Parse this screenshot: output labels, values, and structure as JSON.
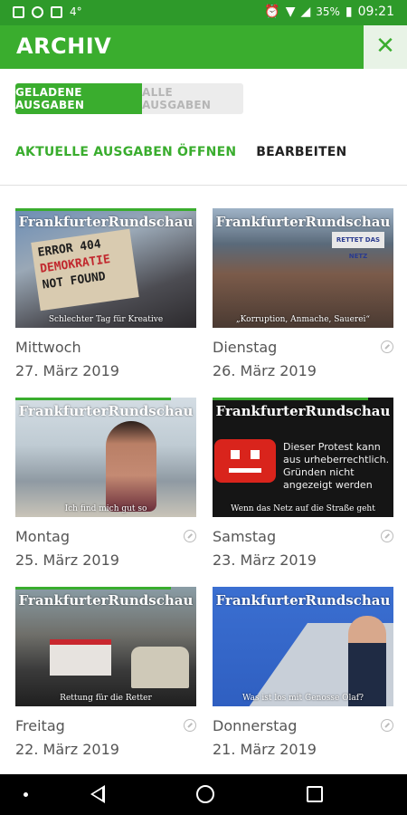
{
  "status": {
    "battery": "35%",
    "time": "09:21",
    "notif_text": "4°"
  },
  "appbar": {
    "title": "ARCHIV",
    "close_icon": "close-icon"
  },
  "segments": {
    "loaded": "GELADENE AUSGABEN",
    "all": "ALLE AUSGABEN"
  },
  "actions": {
    "open_current": "AKTUELLE AUSGABEN ÖFFNEN",
    "edit": "BEARBEITEN"
  },
  "issues": [
    {
      "brand": "FrankfurterRundschau",
      "caption": "Schlechter Tag für Kreative",
      "day": "Mittwoch",
      "date": "27. März 2019",
      "sign_l1": "ERROR 404",
      "sign_l2": "DEMOKRATIE",
      "sign_l3": "NOT FOUND",
      "progress": 1.0,
      "downloaded_icon": false
    },
    {
      "brand": "FrankfurterRundschau",
      "caption": "„Korruption, Anmache, Sauerei“",
      "day": "Dienstag",
      "date": "26. März 2019",
      "banner": "RETTET DAS NETZ",
      "progress": 0.0,
      "downloaded_icon": true
    },
    {
      "brand": "FrankfurterRundschau",
      "caption": "Ich find mich gut so",
      "day": "Montag",
      "date": "25. März 2019",
      "progress": 0.86,
      "downloaded_icon": true
    },
    {
      "brand": "FrankfurterRundschau",
      "caption": "Wenn das Netz auf die Straße geht",
      "day": "Samstag",
      "date": "23. März 2019",
      "chalk_l1": "Dieser Protest kann",
      "chalk_l2": "aus urheberrechtlich.",
      "chalk_l3": "Gründen nicht",
      "chalk_l4": "angezeigt werden",
      "progress": 0.86,
      "downloaded_icon": true
    },
    {
      "brand": "FrankfurterRundschau",
      "caption": "Rettung für die Retter",
      "day": "Freitag",
      "date": "22. März 2019",
      "progress": 0.86,
      "downloaded_icon": true
    },
    {
      "brand": "FrankfurterRundschau",
      "caption": "Was ist los mit Genosse Olaf?",
      "day": "Donnerstag",
      "date": "21. März 2019",
      "progress": 0.0,
      "downloaded_icon": true
    }
  ]
}
